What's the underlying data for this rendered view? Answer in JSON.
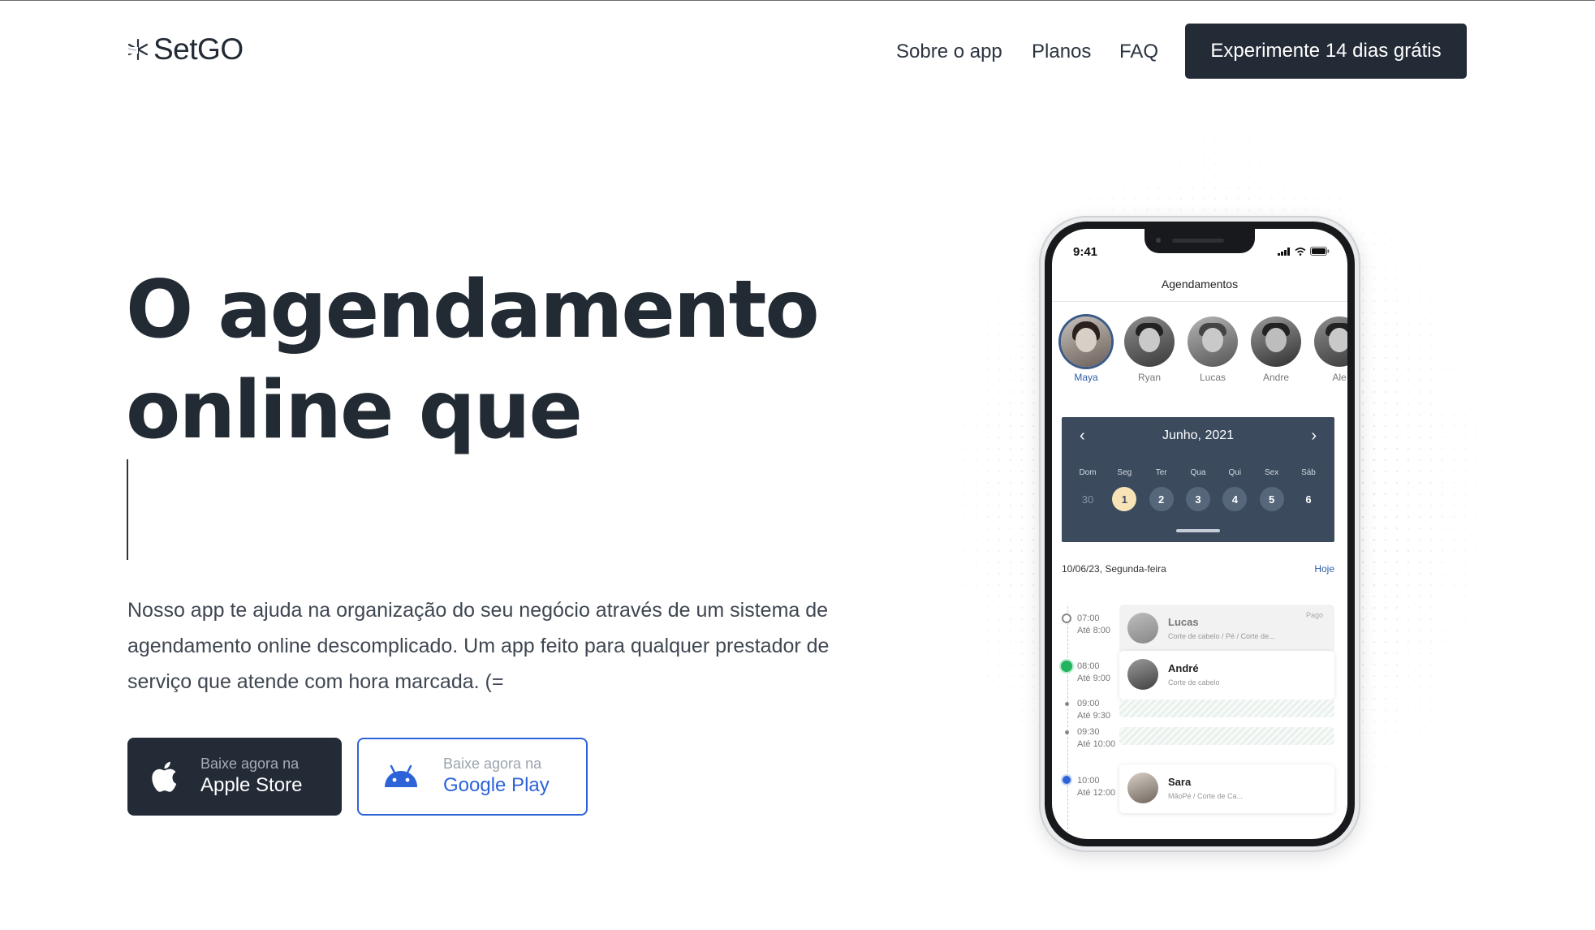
{
  "brand": {
    "name": "SetGO"
  },
  "nav": {
    "links": [
      "Sobre o app",
      "Planos",
      "FAQ"
    ],
    "cta": "Experimente 14 dias grátis"
  },
  "hero": {
    "headline_line1": "O agendamento",
    "headline_line2": "online que",
    "description": "Nosso app te ajuda na organização do seu negócio através de um sistema de agendamento online descomplicado. Um app feito para qualquer prestador de serviço que atende com hora marcada. (=",
    "apple": {
      "small": "Baixe agora na",
      "big": "Apple Store",
      "icon": "apple-icon"
    },
    "google": {
      "small": "Baixe agora na",
      "big": "Google Play",
      "icon": "android-icon"
    }
  },
  "phone": {
    "time": "9:41",
    "title": "Agendamentos",
    "professionals": [
      "Maya",
      "Ryan",
      "Lucas",
      "Andre",
      "Ale"
    ],
    "selected_professional": "Maya",
    "calendar": {
      "month": "Junho, 2021",
      "weekdays": [
        "Dom",
        "Seg",
        "Ter",
        "Qua",
        "Qui",
        "Sex",
        "Sáb"
      ],
      "dates": [
        "30",
        "1",
        "2",
        "3",
        "4",
        "5",
        "6"
      ],
      "selected_date": "1"
    },
    "day_label": "10/06/23, Segunda-feira",
    "today_label": "Hoje",
    "appointments": [
      {
        "start": "07:00",
        "end": "Até 8:00",
        "name": "Lucas",
        "service": "Corte de cabelo / Pé / Corte de...",
        "tag": "Pago"
      },
      {
        "start": "08:00",
        "end": "Até 9:00",
        "name": "André",
        "service": "Corte de cabelo"
      },
      {
        "start": "09:00",
        "end": "Até 9:30"
      },
      {
        "start": "09:30",
        "end": "Até 10:00"
      },
      {
        "start": "10:00",
        "end": "Até 12:00",
        "name": "Sara",
        "service": "MãoPé / Corte de Ca..."
      }
    ]
  },
  "colors": {
    "dark": "#232b37",
    "accent": "#2d63d8",
    "calendar": "#3b4a5d",
    "today": "#f7e3b5",
    "active": "#22b35e"
  }
}
